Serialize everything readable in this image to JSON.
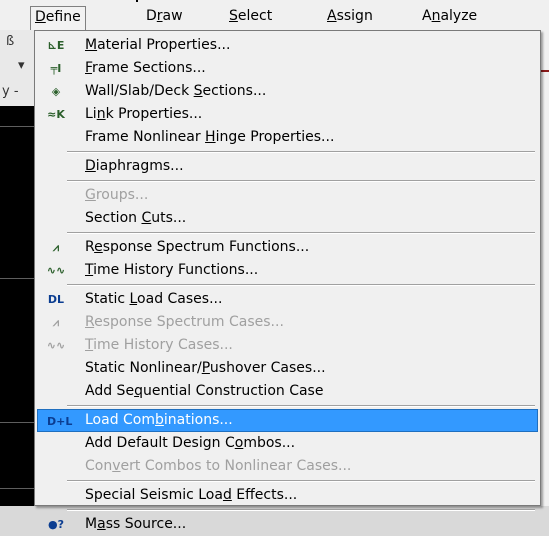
{
  "menubar": {
    "menus": [
      {
        "pre": "",
        "key": "D",
        "post": "efine",
        "open": true
      },
      {
        "pre": "D",
        "key": "r",
        "post": "aw",
        "open": false
      },
      {
        "pre": "",
        "key": "S",
        "post": "elect",
        "open": false
      },
      {
        "pre": "",
        "key": "A",
        "post": "ssign",
        "open": false
      },
      {
        "pre": "A",
        "key": "n",
        "post": "alyze",
        "open": false
      }
    ]
  },
  "define_menu": {
    "items": [
      {
        "pre": "",
        "key": "M",
        "post": "aterial Properties...",
        "icon": "material-properties-icon",
        "glyph": "⊾E",
        "disabled": false,
        "selected": false
      },
      {
        "pre": "",
        "key": "F",
        "post": "rame Sections...",
        "icon": "frame-sections-icon",
        "glyph": "╤I",
        "disabled": false,
        "selected": false
      },
      {
        "pre": "Wall/Slab/Deck ",
        "key": "S",
        "post": "ections...",
        "icon": "wall-slab-deck-icon",
        "glyph": "◈",
        "disabled": false,
        "selected": false
      },
      {
        "pre": "Li",
        "key": "n",
        "post": "k Properties...",
        "icon": "link-properties-icon",
        "glyph": "≈K",
        "disabled": false,
        "selected": false
      },
      {
        "pre": "Frame Nonlinear ",
        "key": "H",
        "post": "inge Properties...",
        "icon": "",
        "glyph": "",
        "disabled": false,
        "selected": false
      },
      {
        "separator": true
      },
      {
        "pre": "",
        "key": "D",
        "post": "iaphragms...",
        "icon": "",
        "glyph": "",
        "disabled": false,
        "selected": false
      },
      {
        "separator": true
      },
      {
        "pre": "",
        "key": "G",
        "post": "roups...",
        "icon": "",
        "glyph": "",
        "disabled": true,
        "selected": false
      },
      {
        "pre": "Section ",
        "key": "C",
        "post": "uts...",
        "icon": "",
        "glyph": "",
        "disabled": false,
        "selected": false
      },
      {
        "separator": true
      },
      {
        "pre": "R",
        "key": "e",
        "post": "sponse Spectrum Functions...",
        "icon": "response-spectrum-functions-icon",
        "glyph": "⩘",
        "disabled": false,
        "selected": false
      },
      {
        "pre": "",
        "key": "T",
        "post": "ime History Functions...",
        "icon": "time-history-functions-icon",
        "glyph": "∿∿",
        "disabled": false,
        "selected": false
      },
      {
        "separator": true
      },
      {
        "pre": "Static ",
        "key": "L",
        "post": "oad Cases...",
        "icon": "static-load-cases-icon",
        "glyph": "DL",
        "disabled": false,
        "selected": false
      },
      {
        "pre": "",
        "key": "R",
        "post": "esponse Spectrum Cases...",
        "icon": "response-spectrum-cases-icon",
        "glyph": "⩘",
        "disabled": true,
        "selected": false
      },
      {
        "pre": "",
        "key": "T",
        "post": "ime History Cases...",
        "icon": "time-history-cases-icon",
        "glyph": "∿∿",
        "disabled": true,
        "selected": false
      },
      {
        "pre": "Static Nonlinear/",
        "key": "P",
        "post": "ushover Cases...",
        "icon": "",
        "glyph": "",
        "disabled": false,
        "selected": false
      },
      {
        "pre": "Add Se",
        "key": "q",
        "post": "uential Construction Case",
        "icon": "",
        "glyph": "",
        "disabled": false,
        "selected": false
      },
      {
        "separator": true
      },
      {
        "pre": "Load Com",
        "key": "b",
        "post": "inations...",
        "icon": "load-combinations-icon",
        "glyph": "D+L",
        "disabled": false,
        "selected": true
      },
      {
        "pre": "Add Default Design C",
        "key": "o",
        "post": "mbos...",
        "icon": "",
        "glyph": "",
        "disabled": false,
        "selected": false
      },
      {
        "pre": "Con",
        "key": "v",
        "post": "ert Combos to Nonlinear Cases...",
        "icon": "",
        "glyph": "",
        "disabled": true,
        "selected": false
      },
      {
        "separator": true
      },
      {
        "pre": "Special Seismic Loa",
        "key": "d",
        "post": " Effects...",
        "icon": "",
        "glyph": "",
        "disabled": false,
        "selected": false
      },
      {
        "separator": true
      },
      {
        "pre": "M",
        "key": "a",
        "post": "ss Source...",
        "icon": "mass-source-icon",
        "glyph": "●?",
        "disabled": false,
        "selected": false
      }
    ]
  },
  "colors": {
    "menu_bg": "#f0f0f0",
    "highlight": "#3399ff",
    "disabled_text": "#a0a0a0",
    "canvas": "#000000"
  }
}
